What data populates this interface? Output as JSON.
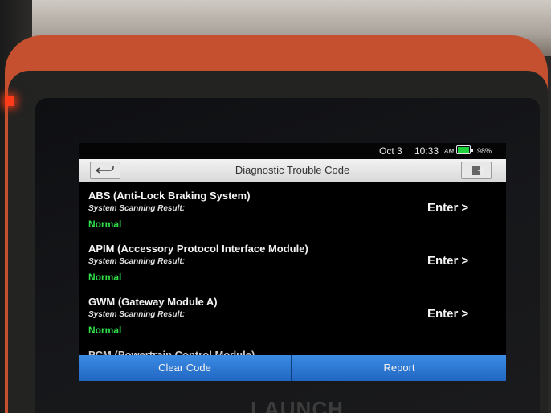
{
  "status_bar": {
    "date": "Oct 3",
    "time": "10:33",
    "ampm": "AM",
    "battery_percent": "98%",
    "battery_level": 0.98,
    "battery_color": "#21d13e"
  },
  "header": {
    "title": "Diagnostic Trouble Code",
    "back_icon": "back-arrow-icon",
    "exit_icon": "exit-icon"
  },
  "modules": [
    {
      "name": "ABS (Anti-Lock Braking System)",
      "result_label": "System Scanning Result:",
      "status": "Normal",
      "action": "Enter >"
    },
    {
      "name": "APIM (Accessory Protocol Interface Module)",
      "result_label": "System Scanning Result:",
      "status": "Normal",
      "action": "Enter >"
    },
    {
      "name": "GWM (Gateway Module A)",
      "result_label": "System Scanning Result:",
      "status": "Normal",
      "action": "Enter >"
    },
    {
      "name": "PCM (Powertrain Control Module)"
    }
  ],
  "footer": {
    "clear_label": "Clear Code",
    "report_label": "Report"
  },
  "colors": {
    "status_normal": "#2fe04a",
    "button_blue": "#2a79d4",
    "device_shell": "#c4502f"
  },
  "brand": "LAUNCH"
}
